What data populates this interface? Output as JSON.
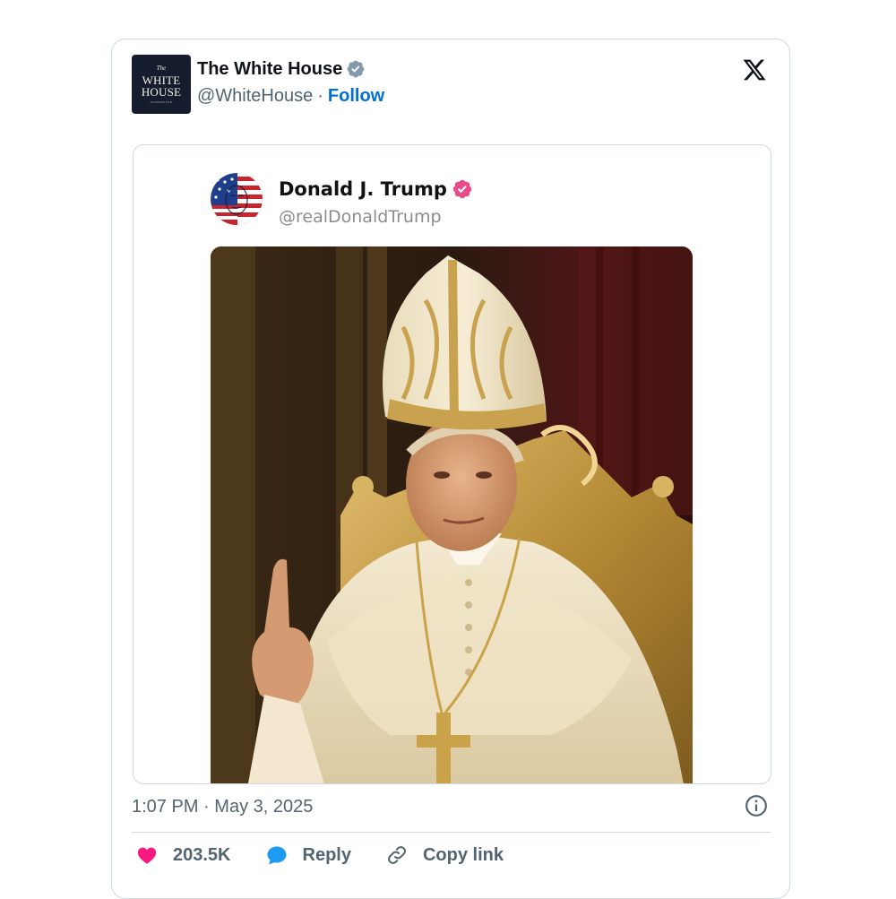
{
  "account": {
    "avatar_text_top": "The",
    "avatar_text_line1": "WHITE",
    "avatar_text_line2": "HOUSE",
    "avatar_text_bottom": "WASHINGTON",
    "name": "The White House",
    "handle": "@WhiteHouse",
    "separator": "·",
    "follow_label": "Follow",
    "verified_badge_color": "#829aab"
  },
  "platform": {
    "logo_icon": "x-logo-icon"
  },
  "embedded_post": {
    "name": "Donald J. Trump",
    "handle": "@realDonaldTrump",
    "verified_badge_color": "#ea4c89",
    "avatar_icon": "flag-face-avatar",
    "image_description_icon": "photo"
  },
  "meta": {
    "time": "1:07 PM",
    "separator": "·",
    "date": "May 3, 2025",
    "info_icon": "info-icon"
  },
  "actions": {
    "like_count": "203.5K",
    "like_color": "#f91880",
    "reply_label": "Reply",
    "reply_color": "#1d9bf0",
    "copy_label": "Copy link"
  }
}
